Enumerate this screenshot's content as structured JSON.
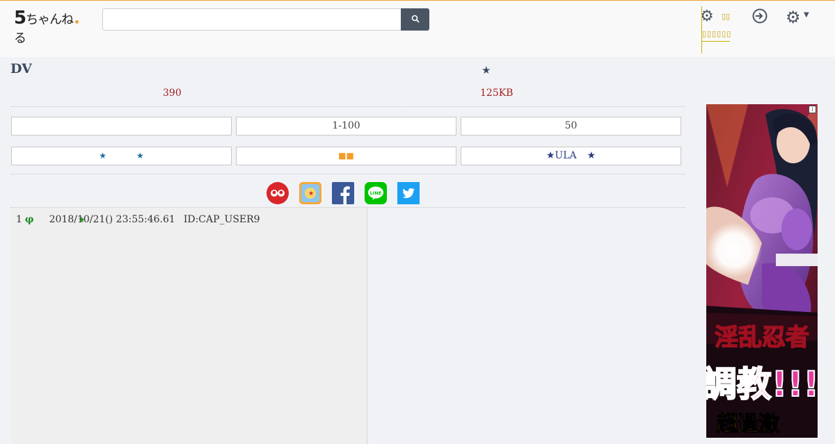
{
  "header": {
    "logo_text": "ちゃんねる",
    "logo_number": "5",
    "search_placeholder": "",
    "search_icon": "search-icon",
    "popup_label": "",
    "icons": [
      "gear-icon",
      "login-icon",
      "settings-icon",
      "chevron-down-icon"
    ]
  },
  "thread": {
    "title": "DV",
    "title_star": "★",
    "response_count": "390",
    "size": "125KB"
  },
  "nav_buttons": {
    "row1": [
      "",
      "1-100",
      "50"
    ],
    "row2_left_stars": [
      "★",
      "★"
    ],
    "row2_mid": "■■",
    "row2_right": {
      "prefix": "★ULA",
      "suffix": "★"
    }
  },
  "share_icons": [
    "2ch-icon",
    "bookmark-icon",
    "facebook-icon",
    "line-icon",
    "twitter-icon"
  ],
  "first_post": {
    "number": "1",
    "name": "φ",
    "star": "★",
    "date": "2018/10/21() 23:55:46.61",
    "id": "ID:CAP_USER9"
  },
  "ad": {
    "headline1": "淫乱忍者",
    "headline2": "調教!!!",
    "headline3": "超過激",
    "info_label": "i"
  },
  "colors": {
    "topbar_bg": "#f9f9f9",
    "page_bg": "#f1f2f6",
    "accent_red": "#a31e1e",
    "post_name_green": "#228b22",
    "search_btn": "#4a5563",
    "facebook": "#3b5998",
    "line": "#00c300",
    "twitter": "#1da1f2"
  }
}
